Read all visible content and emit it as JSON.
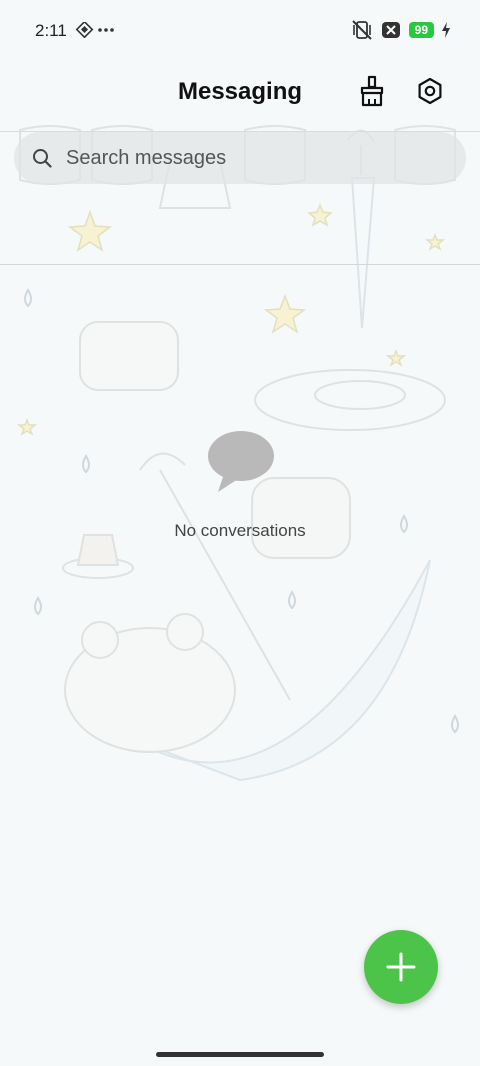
{
  "status_bar": {
    "time": "2:11",
    "battery_level": "99",
    "icons": [
      "diamond-app-icon",
      "more-dots-icon",
      "vibrate-off-icon",
      "blocked-signal-icon",
      "charging-bolt-icon"
    ]
  },
  "header": {
    "title": "Messaging",
    "buttons": [
      "broom-clean-icon",
      "settings-icon"
    ]
  },
  "search": {
    "placeholder": "Search messages",
    "value": ""
  },
  "empty_state": {
    "message": "No conversations",
    "icon": "chat-bubble-icon"
  },
  "fab": {
    "icon": "plus-icon"
  },
  "colors": {
    "accent": "#4cc44a",
    "battery": "#28c840",
    "background": "#f6f9f9"
  }
}
